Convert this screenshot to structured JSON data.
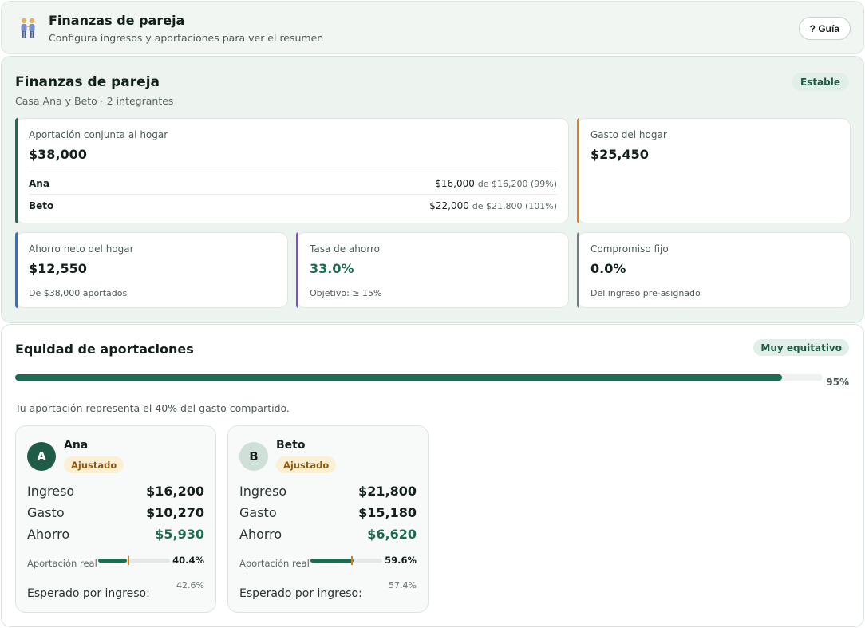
{
  "header": {
    "icon": "couple-icon",
    "title": "Finanzas de pareja",
    "subtitle": "Configura ingresos y aportaciones para ver el resumen",
    "guide_label": "? Guía"
  },
  "summary": {
    "title": "Finanzas de pareja",
    "subtitle": "Casa Ana y Beto · 2 integrantes",
    "status": "Estable",
    "joint": {
      "label": "Aportación conjunta al hogar",
      "value": "$38,000",
      "rows": [
        {
          "name": "Ana",
          "amount": "$16,000",
          "detail": "de $16,200 (99%)"
        },
        {
          "name": "Beto",
          "amount": "$22,000",
          "detail": "de $21,800 (101%)"
        }
      ]
    },
    "household_expense": {
      "label": "Gasto del hogar",
      "value": "$25,450"
    },
    "net_savings": {
      "label": "Ahorro neto del hogar",
      "value": "$12,550",
      "note": "De $38,000 aportados"
    },
    "savings_rate": {
      "label": "Tasa de ahorro",
      "value": "33.0%",
      "note": "Objetivo: ≥ 15%"
    },
    "fixed_commitment": {
      "label": "Compromiso fijo",
      "value": "0.0%",
      "note": "Del ingreso pre-asignado"
    }
  },
  "equity": {
    "title": "Equidad de aportaciones",
    "badge": "Muy equitativo",
    "progress": 0.95,
    "progress_label": "95%",
    "note": "Tu aportación representa el 40% del gasto compartido.",
    "members": [
      {
        "initial": "A",
        "name": "Ana",
        "badge": "Ajustado",
        "income_label": "Ingreso",
        "income": "$16,200",
        "expense_label": "Gasto",
        "expense": "$10,270",
        "savings_label": "Ahorro",
        "savings": "$5,930",
        "contribution_label": "Aportación real",
        "contribution": 0.404,
        "contribution_text": "40.4%",
        "expected_label": "Esperado por ingreso:",
        "expected": 0.426,
        "expected_text": "42.6%"
      },
      {
        "initial": "B",
        "name": "Beto",
        "badge": "Ajustado",
        "income_label": "Ingreso",
        "income": "$21,800",
        "expense_label": "Gasto",
        "expense": "$15,180",
        "savings_label": "Ahorro",
        "savings": "$6,620",
        "contribution_label": "Aportación real",
        "contribution": 0.596,
        "contribution_text": "59.6%",
        "expected_label": "Esperado por ingreso:",
        "expected": 0.574,
        "expected_text": "57.4%"
      }
    ]
  },
  "colors": {
    "accent_green": "#1f6a52",
    "accent_orange": "#d9821f",
    "accent_blue": "#2f6fd6",
    "accent_purple": "#7b4fd0",
    "accent_slate": "#6f7d87"
  }
}
